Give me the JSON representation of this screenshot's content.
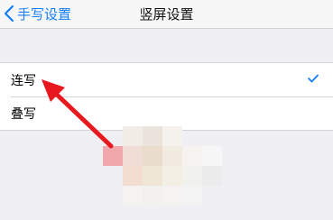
{
  "navbar": {
    "back_label": "手写设置",
    "title": "竖屏设置"
  },
  "options": [
    {
      "label": "连写",
      "selected": true
    },
    {
      "label": "叠写",
      "selected": false
    }
  ],
  "colors": {
    "accent": "#157efb",
    "annotation_arrow": "#e8191e",
    "background": "#efeff4"
  },
  "annotation": {
    "type": "arrow",
    "points_to": "连写"
  }
}
